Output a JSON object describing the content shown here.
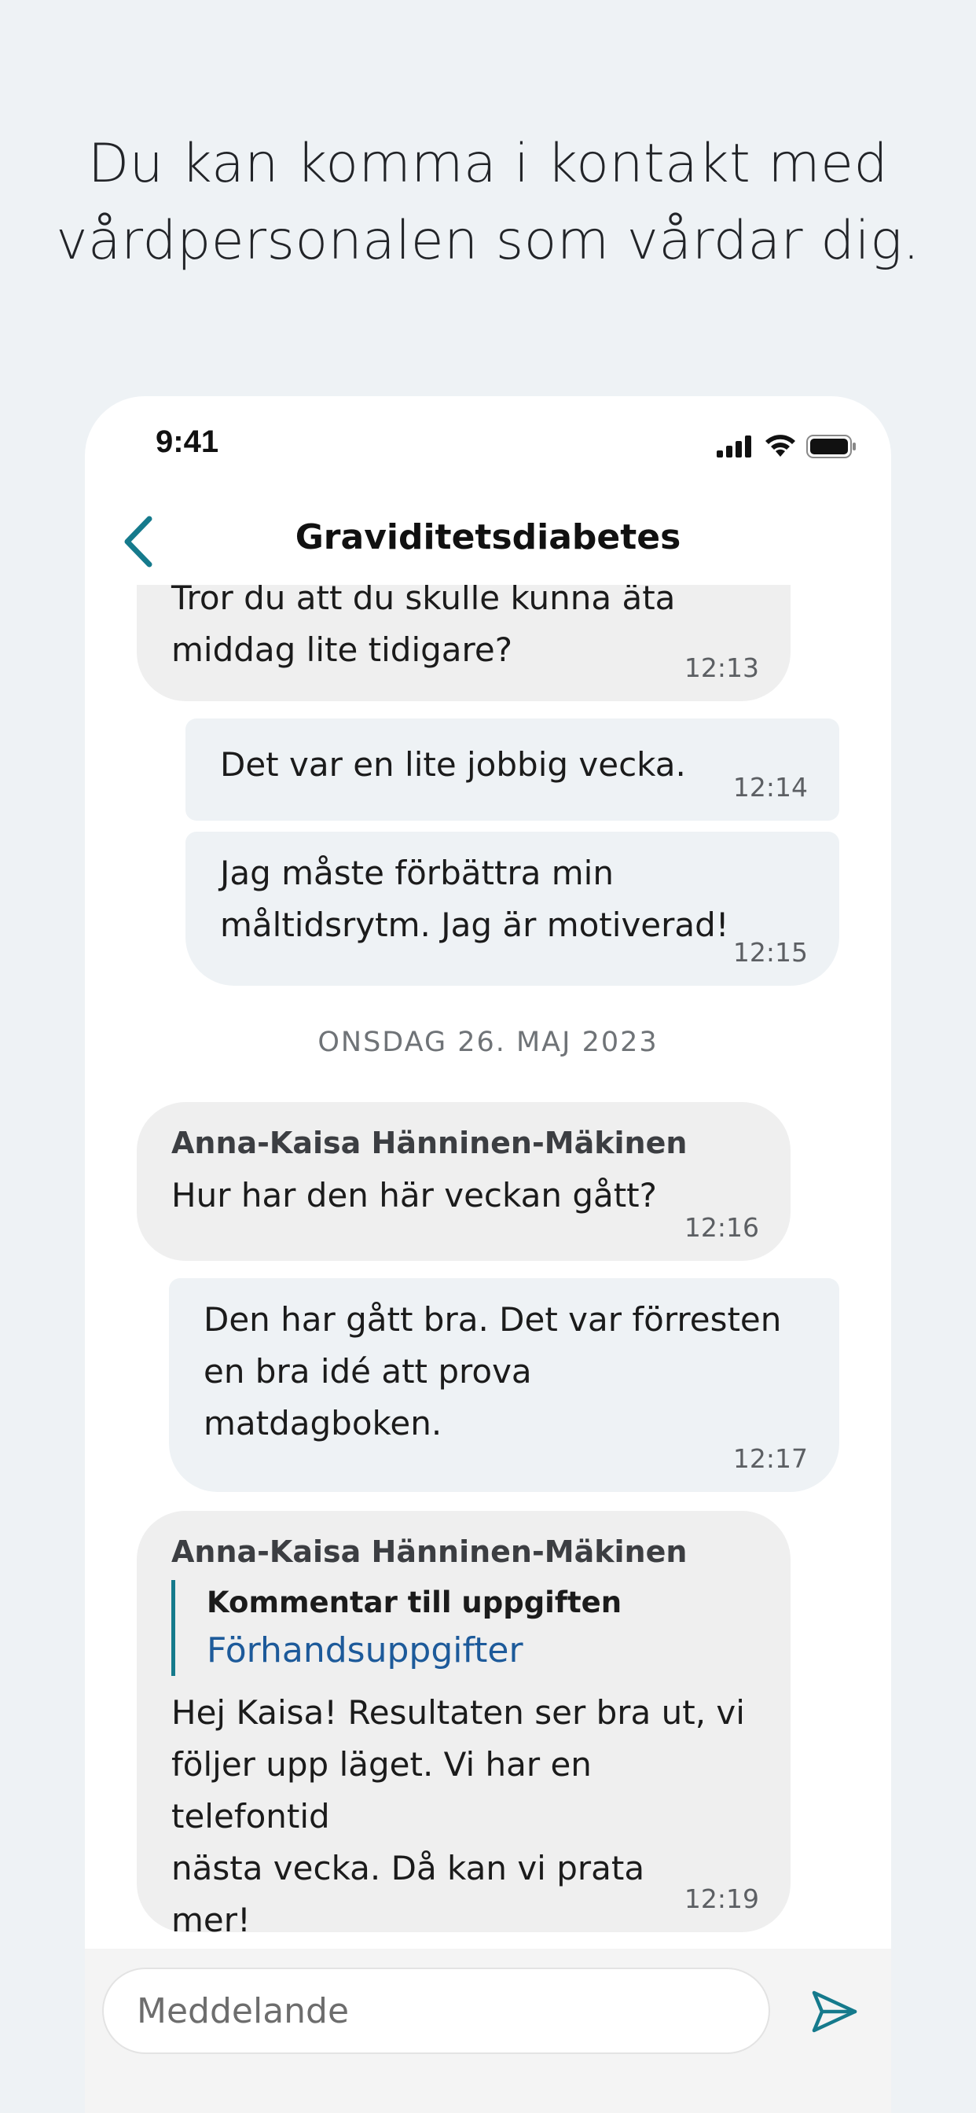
{
  "headline": {
    "line1": "Du kan komma i kontakt med",
    "line2": "vårdpersonalen som vårdar dig."
  },
  "status_bar": {
    "time": "9:41",
    "icons": [
      "signal-icon",
      "wifi-icon",
      "battery-icon"
    ]
  },
  "nav": {
    "back_icon": "chevron-left-icon",
    "title": "Graviditetsdiabetes"
  },
  "messages": [
    {
      "direction": "in",
      "text_line1": "Tror du att du skulle kunna äta",
      "text_line2": "middag lite tidigare?",
      "time": "12:13"
    },
    {
      "direction": "out",
      "text": "Det var en lite jobbig vecka.",
      "time": "12:14"
    },
    {
      "direction": "out",
      "text_line1": "Jag måste förbättra min",
      "text_line2": "måltidsrytm. Jag är motiverad!",
      "time": "12:15"
    },
    {
      "direction": "in",
      "sender": "Anna-Kaisa Hänninen-Mäkinen",
      "text": "Hur har den här veckan gått?",
      "time": "12:16"
    },
    {
      "direction": "out",
      "text_line1": "Den har gått bra. Det var förresten",
      "text_line2": "en bra idé att prova",
      "text_line3": "matdagboken.",
      "time": "12:17"
    },
    {
      "direction": "in",
      "sender": "Anna-Kaisa Hänninen-Mäkinen",
      "quote_title": "Kommentar till uppgiften",
      "quote_link": "Förhandsuppgifter",
      "text_line1": "Hej Kaisa! Resultaten ser bra ut, vi",
      "text_line2": "följer upp läget. Vi har en telefontid",
      "text_line3": "nästa vecka. Då kan vi prata",
      "text_line4": "mer!",
      "time": "12:19"
    }
  ],
  "date_separator": "ONSDAG 26. MAJ 2023",
  "composer": {
    "placeholder": "Meddelande",
    "send_icon": "send-icon"
  },
  "colors": {
    "background": "#eef2f5",
    "incoming_bubble": "#efefef",
    "outgoing_bubble": "#eef2f5",
    "accent": "#157a8c",
    "link": "#1d5a9a"
  }
}
